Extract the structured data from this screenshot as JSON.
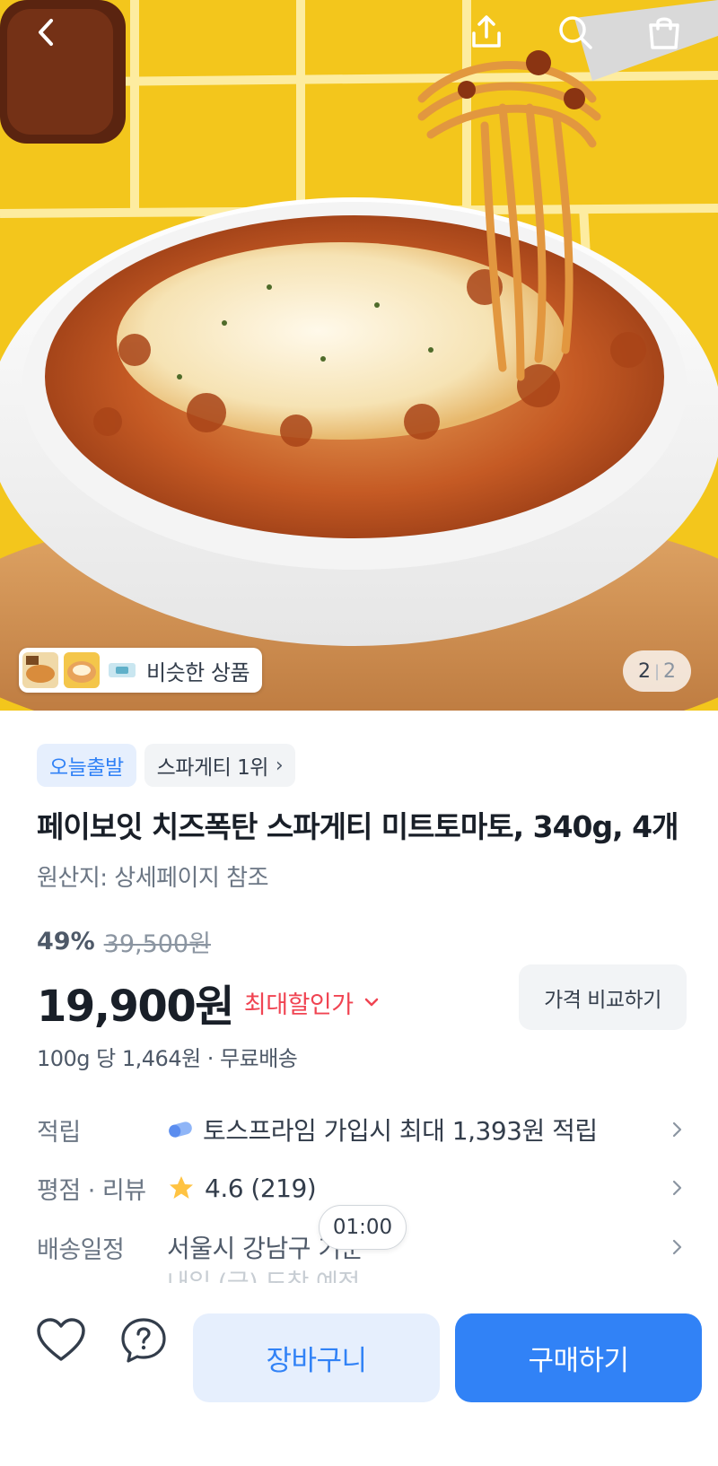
{
  "hero": {
    "similar_label": "비슷한 상품",
    "page_current": "2",
    "page_separator": "|",
    "page_total": "2"
  },
  "badges": {
    "today_ship": "오늘출발",
    "ranking": "스파게티 1위"
  },
  "product": {
    "title": "페이보잇 치즈폭탄 스파게티 미트토마토, 340g, 4개",
    "origin": "원산지: 상세페이지 참조",
    "discount_rate": "49%",
    "original_price": "39,500원",
    "price": "19,900원",
    "max_discount_label": "최대할인가",
    "compare_button": "가격 비교하기",
    "unit_price": "100g 당 1,464원 · 무료배송"
  },
  "info_rows": {
    "points_label": "적립",
    "points_value": "토스프라임 가입시 최대 1,393원 적립",
    "rating_label": "평점 · 리뷰",
    "rating_value": "4.6 (219)",
    "delivery_label": "배송일정",
    "delivery_value": "서울시 강남구 기준",
    "delivery_eta": "내일 (금) 도착 예정"
  },
  "timer": "01:00",
  "bottom_bar": {
    "cart_label": "장바구니",
    "buy_label": "구매하기"
  },
  "colors": {
    "accent_blue": "#3182f6",
    "accent_light_blue": "#e6effd",
    "discount_red": "#f04452",
    "star_yellow": "#ffc342"
  },
  "icons": [
    "back-icon",
    "share-icon",
    "search-icon",
    "shopping-bag-icon",
    "chevron-right-icon",
    "chevron-down-icon",
    "pill-icon",
    "star-icon",
    "heart-icon",
    "question-icon"
  ]
}
